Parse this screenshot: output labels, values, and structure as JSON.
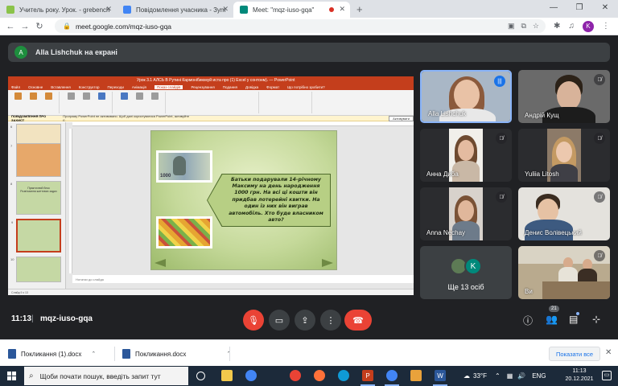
{
  "browser": {
    "tabs": [
      {
        "title": "Учитель року. Урок. - grebench",
        "favicon_color": "#8bc34a",
        "active": false
      },
      {
        "title": "Повідомлення учасника - Зуm",
        "favicon_color": "#4285f4",
        "active": false
      },
      {
        "title": "Meet: \"mqz-iuso-gqa\"",
        "favicon_color": "#00897b",
        "active": true,
        "recording": true
      }
    ],
    "new_tab": "+",
    "window_controls": [
      "—",
      "❐",
      "✕"
    ],
    "url": "meet.google.com/mqz-iuso-gqa",
    "profile_initial": "K"
  },
  "meet": {
    "presenter": {
      "initial": "A",
      "text": "Alla Lishchuk на екрані",
      "color": "#1e8e3e"
    },
    "slide": {
      "callout_text": "Батьки подарували 14-річному Максиму на день народження 1000 грн. На всі ці кошти він придбав лотерейні квитки. На один із них він виграв автомобіль. Хто буде власником авто?",
      "banknote_value": "1000",
      "notes_placeholder": "Нотатки до слайда"
    },
    "ppt": {
      "title": "Урок 3.1 АЛСЬ В Рутині Кармонібиюмуй иста про (1) Excel у сонтонм). — PowerPoint",
      "tabs": [
        "Файл",
        "Основне",
        "Вставлення",
        "Конструктор",
        "Переходи",
        "Анімація",
        "Показ слайдів",
        "Рецензування",
        "Подання",
        "Довідка",
        "Формат",
        "Що потрібно зробити?"
      ],
      "message_label": "ПОВІДОМЛЕННЯ ПРО ЗАХИСТ",
      "message_text": "Програму PowerPoint не активовано. Щоб далі користуватися PowerPoint, активуйте її.",
      "message_button": "Активувати",
      "thumbs": [
        {
          "num": "6",
          "text": ""
        },
        {
          "num": "7",
          "text": ""
        },
        {
          "num": "8",
          "text": "Практичний блок Розв'язання життєвих задач"
        },
        {
          "num": "9",
          "text": ""
        },
        {
          "num": "10",
          "text": ""
        }
      ],
      "status_text": "Слайд 9 з 13"
    },
    "participants": [
      {
        "name": "Alla Lishchuk",
        "speaking": true,
        "bg": "#a9b7c6",
        "skin": "#e9c2a6",
        "hair": "#8b5a3c",
        "shirt": "#e8e8e8"
      },
      {
        "name": "Андрiй Кущ",
        "speaking": false,
        "bg": "#6a6a6a",
        "skin": "#d8b39a",
        "hair": "#2c2218",
        "shirt": "#1c1c1c"
      },
      {
        "name": "Анна Дибa",
        "speaking": false,
        "bg": "#f1efea",
        "skin": "#e4bba0",
        "hair": "#6e4a30",
        "shirt": "#c9b8a6"
      },
      {
        "name": "Yuliia Litosh",
        "speaking": false,
        "bg": "#8c7a68",
        "skin": "#ecc8ae",
        "hair": "#c49a63",
        "shirt": "#3f3f46"
      },
      {
        "name": "Anna Nechay",
        "speaking": false,
        "bg": "#d8d2cc",
        "skin": "#e0b79b",
        "hair": "#7a5236",
        "shirt": "#6d7b8a"
      },
      {
        "name": "Денис Волівецький",
        "speaking": false,
        "bg": "#e4e2dd",
        "skin": "#e6c2a4",
        "hair": "#3a2c20",
        "shirt": "#3d5a80"
      },
      {
        "name": "Ще 13 осіб",
        "more": true
      },
      {
        "name": "Ви",
        "speaking": false,
        "bg": "#b9aa8e",
        "skin": "#d7ab8c",
        "hair": "#3b2e24",
        "shirt": "#e7e3d8"
      }
    ],
    "more_avatars": [
      {
        "initial": "",
        "color": "#5d7b55"
      },
      {
        "initial": "K",
        "color": "#00897b"
      }
    ],
    "bottom": {
      "time": "11:13",
      "meeting_code": "mqz-iuso-gqa",
      "participant_count": "21"
    }
  },
  "downloads": {
    "items": [
      "Покликання (1).docx",
      "Покликання.docx"
    ],
    "show_all": "Показати все"
  },
  "taskbar": {
    "search_placeholder": "Щоби почати пошук, введіть запит тут",
    "weather": "33°F",
    "language": "ENG",
    "time": "11:13",
    "date": "20.12.2021",
    "apps": [
      {
        "name": "task-view-icon",
        "color": "#1c2a3a"
      },
      {
        "name": "file-explorer-icon",
        "color": "#f2c94c"
      },
      {
        "name": "chrome-icon",
        "color": "#4285f4"
      },
      {
        "name": "firefox-icon",
        "color": "#ff7139"
      },
      {
        "name": "edge-icon",
        "color": "#0f9ad6"
      },
      {
        "name": "powerpoint-icon",
        "color": "#c43e1c"
      },
      {
        "name": "chrome-meet-icon",
        "color": "#4285f4"
      },
      {
        "name": "photo-icon",
        "color": "#e9a23b"
      },
      {
        "name": "word-icon",
        "color": "#2b579a"
      }
    ]
  }
}
